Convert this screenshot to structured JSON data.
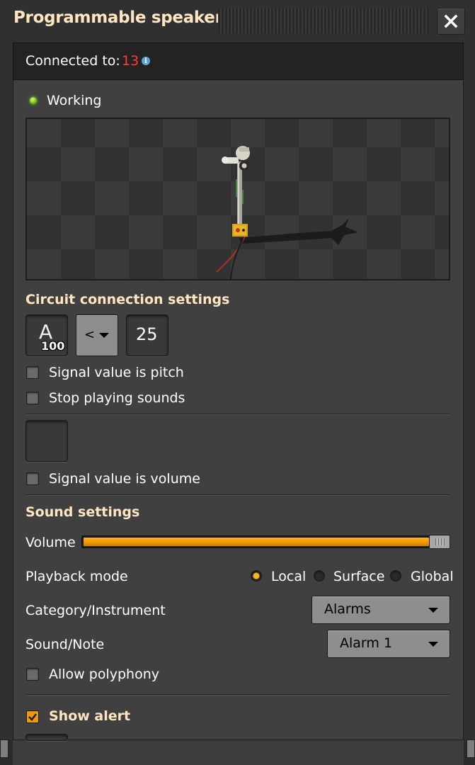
{
  "window": {
    "title": "Programmable speaker",
    "close_icon": "close-icon"
  },
  "connection": {
    "label": "Connected to:",
    "value": "13",
    "value_color": "#ff3b3b",
    "info_icon": "info-icon"
  },
  "status": {
    "label": "Working",
    "indicator_color": "#6fbf12"
  },
  "circuit": {
    "heading": "Circuit connection settings",
    "signal": {
      "glyph": "A",
      "count": "100"
    },
    "comparator": "<",
    "constant": "25",
    "options": [
      {
        "label": "Signal value is pitch",
        "checked": false
      },
      {
        "label": "Stop playing sounds",
        "checked": false
      }
    ],
    "volume_option": {
      "label": "Signal value is volume",
      "checked": false
    }
  },
  "sound": {
    "heading": "Sound settings",
    "volume_label": "Volume",
    "volume_level": 0.95,
    "accent_color": "#f19800",
    "playback_label": "Playback mode",
    "playback_modes": [
      {
        "label": "Local",
        "selected": true
      },
      {
        "label": "Surface",
        "selected": false
      },
      {
        "label": "Global",
        "selected": false
      }
    ],
    "category_label": "Category/Instrument",
    "category_value": "Alarms",
    "note_label": "Sound/Note",
    "note_value": "Alarm 1",
    "polyphony_label": "Allow polyphony",
    "polyphony_checked": false
  },
  "alert": {
    "label": "Show alert",
    "checked": true
  }
}
